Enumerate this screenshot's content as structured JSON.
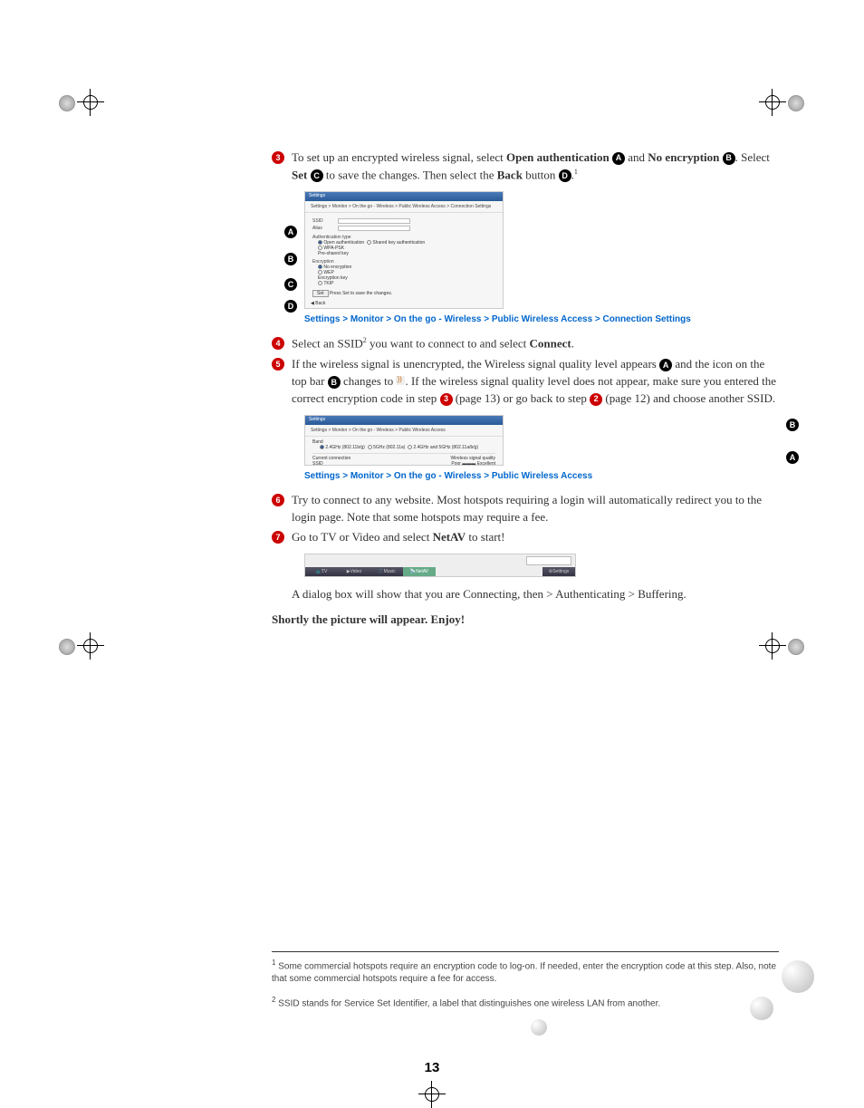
{
  "steps": {
    "s3": {
      "num": "3",
      "text_a": "To set up an    encrypted wireless signal, select ",
      "open_auth": "Open authentication",
      "and": " and ",
      "no_enc": "No encryption",
      "text_b": ". Select ",
      "set": "Set",
      "text_c": " to save the changes. Then select the ",
      "back": "Back",
      "text_d": " button ",
      "period": ".",
      "fn": "1"
    },
    "s4": {
      "num": "4",
      "text_a": "Select an SSID",
      "fn": "2",
      "text_b": " you want to connect to and select ",
      "connect": "Connect",
      "text_c": "."
    },
    "s5": {
      "num": "5",
      "text_a": "If the wireless signal is unencrypted, the Wireless signal quality level appears ",
      "text_b": " and the icon on the top bar ",
      "text_c": " changes to ",
      "text_d": ". If the wireless signal quality level does not appear, make sure you entered the correct encryption code in step ",
      "text_e": " (page 13) or go back to step ",
      "text_f": " (page 12) and choose another SSID."
    },
    "s6": {
      "num": "6",
      "text": "Try to connect to any website. Most hotspots requiring a login will automatically redirect you to the login page. Note that some hotspots may require a fee."
    },
    "s7": {
      "num": "7",
      "text_a": "Go to TV or Video and select ",
      "netav": "NetAV",
      "text_b": " to start!"
    }
  },
  "breadcrumb1": "Settings > Monitor > On the go - Wireless > Public Wireless Access > Connection Settings",
  "breadcrumb2": "Settings > Monitor > On the go - Wireless > Public Wireless Access",
  "dialog_note": "A dialog box will show that you are Connecting, then > Authenticating > Buffering.",
  "enjoy": "Shortly the picture will appear. Enjoy!",
  "footnote1": "Some commercial hotspots require an encryption code to log-on. If needed, enter the encryption code at this step. Also, note that some commercial hotspots require a fee for access.",
  "footnote2": "SSID stands for Service Set Identifier, a label that distinguishes one wireless LAN from another.",
  "page_number": "13",
  "callouts": {
    "A": "A",
    "B": "B",
    "C": "C",
    "D": "D"
  },
  "shot1": {
    "header": "Settings",
    "crumb": "Settings > Monitor > On the go - Wireless > Public Wireless Access > Connection Settings",
    "ssid": "SSID",
    "alias": "Alias",
    "auth": "Authentication type",
    "openauth": "Open authentication",
    "shared": "Shared key authentication",
    "wpa": "WPA-PSK",
    "preshared": "Pre-shared key",
    "enc": "Encryption",
    "noenc": "No encryption",
    "wep": "WEP",
    "enckey": "Encryption key",
    "tkip": "TKIP",
    "set": "Set",
    "setmsg": "Press Set to save the changes.",
    "back": "Back"
  },
  "shot2": {
    "header": "Settings",
    "crumb": "Settings > Monitor > On the go - Wireless > Public Wireless Access",
    "band": "Band",
    "band1": "2.4GHz (802.11b/g)",
    "band2": "5GHz (802.11a)",
    "band3": "2.4GHz and 5GHz (802.11a/b/g)",
    "current": "Current connection",
    "ssid": "SSID",
    "quality": "Wireless signal quality",
    "poor": "Poor",
    "excellent": "Excellent"
  },
  "shot3": {
    "tv": "TV",
    "video": "Video",
    "music": "Music",
    "netav": "NetAV",
    "settings": "Settings"
  },
  "inline_bullets": {
    "b3": "3",
    "b2": "2"
  }
}
